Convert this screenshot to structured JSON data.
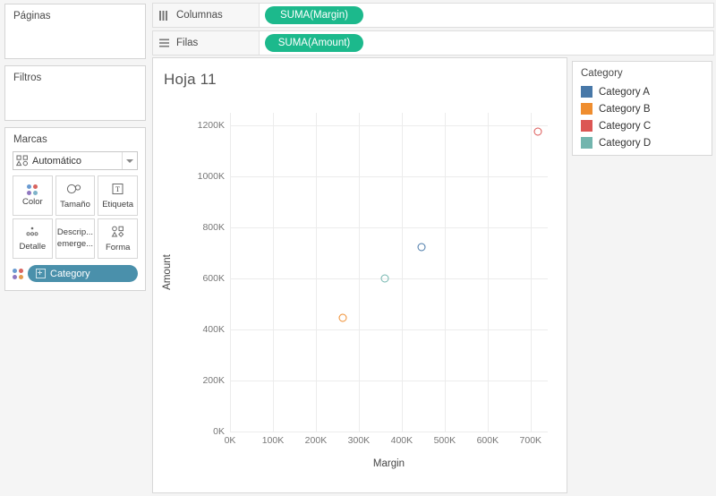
{
  "left_panel": {
    "paginas": {
      "title": "Páginas"
    },
    "filtros": {
      "title": "Filtros"
    },
    "marcas": {
      "title": "Marcas",
      "mark_type": "Automático",
      "mark_type_icon": "mark-type-icon",
      "caret_icon": "chevron-down-icon",
      "buttons": [
        {
          "label": "Color",
          "icon": "color-dots-icon"
        },
        {
          "label": "Tamaño",
          "icon": "size-circles-icon"
        },
        {
          "label": "Etiqueta",
          "icon": "label-text-icon"
        },
        {
          "label": "Detalle",
          "icon": "detail-dots-icon"
        },
        {
          "label": "Descrip... emerge...",
          "label_line1": "Descrip...",
          "label_line2": "emerge...",
          "icon": "tooltip-icon"
        },
        {
          "label": "Forma",
          "icon": "shape-icon"
        }
      ],
      "pill": {
        "label": "Category",
        "icon": "color-dots-icon",
        "field_icon": "dimension-grid-icon",
        "color": "#4a90ab"
      }
    }
  },
  "shelves": [
    {
      "name": "columnas",
      "label": "Columnas",
      "icon": "columns-icon",
      "field": "SUMA(Margin)",
      "field_color": "#1cb98c"
    },
    {
      "name": "filas",
      "label": "Filas",
      "icon": "rows-icon",
      "field": "SUMA(Amount)",
      "field_color": "#1cb98c"
    }
  ],
  "worksheet": {
    "title": "Hoja 11"
  },
  "legend": {
    "title": "Category",
    "items": [
      {
        "label": "Category A",
        "color": "#4878a8"
      },
      {
        "label": "Category B",
        "color": "#ef8d2f"
      },
      {
        "label": "Category C",
        "color": "#dc5654"
      },
      {
        "label": "Category D",
        "color": "#72b5ae"
      }
    ]
  },
  "chart_data": {
    "type": "scatter",
    "title": "Hoja 11",
    "xlabel": "Margin",
    "ylabel": "Amount",
    "xlim": [
      0,
      740
    ],
    "ylim": [
      0,
      1250
    ],
    "xticks": [
      "0K",
      "100K",
      "200K",
      "300K",
      "400K",
      "500K",
      "600K",
      "700K"
    ],
    "xtick_values": [
      0,
      100,
      200,
      300,
      400,
      500,
      600,
      700
    ],
    "yticks": [
      "0K",
      "200K",
      "400K",
      "600K",
      "800K",
      "1000K",
      "1200K"
    ],
    "ytick_values": [
      0,
      200,
      400,
      600,
      800,
      1000,
      1200
    ],
    "grid": true,
    "legend_position": "right",
    "series": [
      {
        "name": "Category A",
        "color": "#4878a8",
        "x": 447,
        "y": 723
      },
      {
        "name": "Category B",
        "color": "#ef8d2f",
        "x": 263,
        "y": 445
      },
      {
        "name": "Category C",
        "color": "#dc5654",
        "x": 718,
        "y": 1176
      },
      {
        "name": "Category D",
        "color": "#72b5ae",
        "x": 360,
        "y": 600
      }
    ]
  }
}
